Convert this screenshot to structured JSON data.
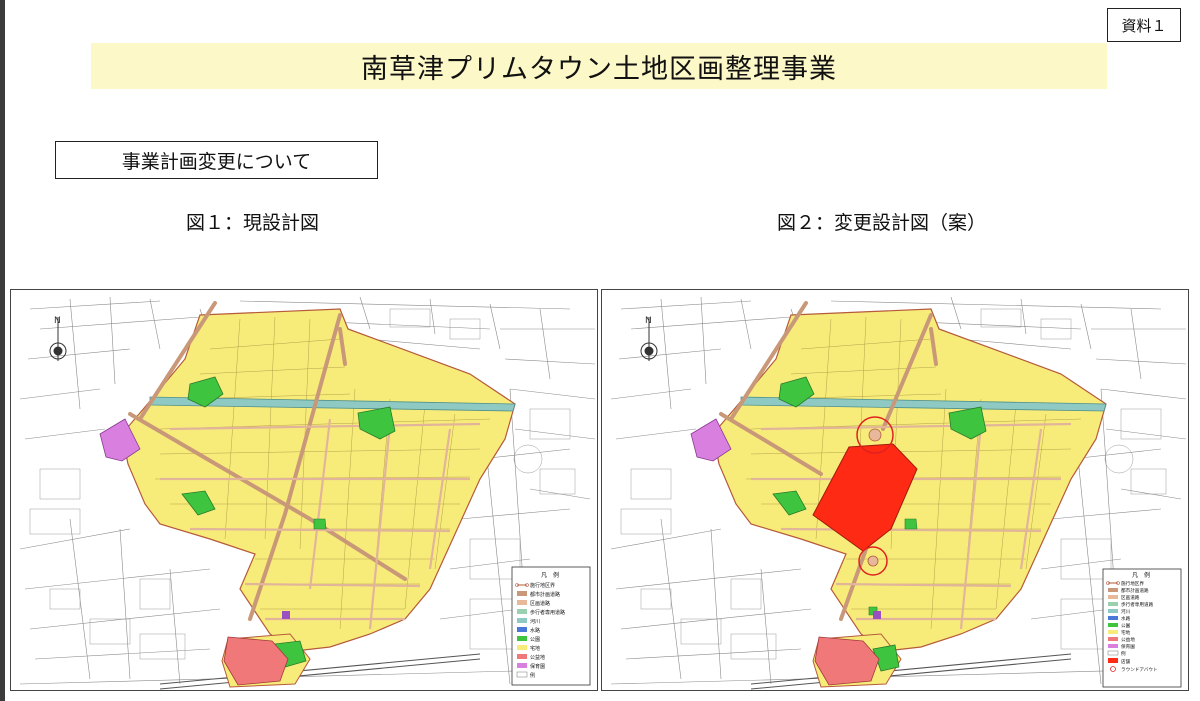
{
  "header": {
    "badge": "資料１",
    "title": "南草津プリムタウン土地区画整理事業",
    "subtitle": "事業計画変更について"
  },
  "figures": [
    {
      "caption": "図１：現設計図"
    },
    {
      "caption": "図２：変更設計図（案）"
    }
  ],
  "legend": {
    "title": "凡　例",
    "items_common": [
      "施行地区界",
      "都市計画道路",
      "区画道路",
      "歩行者専用道路",
      "河川",
      "水路",
      "公園",
      "宅地",
      "公益地",
      "保育園",
      "例"
    ],
    "items_extra": [
      "店舗",
      "ラウンドアバウト"
    ]
  },
  "map_labels": {
    "north": "N"
  },
  "colors": {
    "residential": "#f7ec7a",
    "road": "#e8b89a",
    "road_main": "#c89878",
    "park": "#3fc43f",
    "nursery": "#d97fe0",
    "public": "#f07878",
    "store": "#ff2a14",
    "river": "#8fc9c4",
    "base_lines": "#6f6f6f"
  }
}
